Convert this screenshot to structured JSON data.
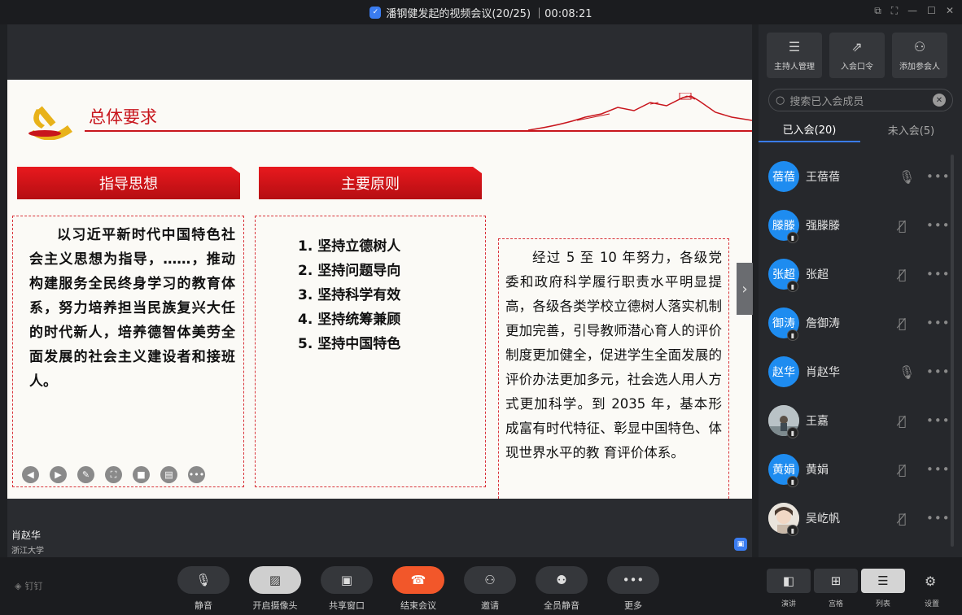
{
  "window": {
    "title": "潘钢健发起的视频会议(20/25) ｜00:08:21",
    "controls": [
      "⧉",
      "⛶",
      "—",
      "☐",
      "✕"
    ]
  },
  "slide": {
    "title": "总体要求",
    "banner_left": "指导思想",
    "banner_middle": "主要原则",
    "guiding_text": "以习近平新时代中国特色社会主义思想为指导，……，推动构建服务全民终身学习的教育体系，努力培养担当民族复兴大任 的时代新人，培养德智体美劳全面发展的社会主义建设者和接班人。",
    "principles": [
      "1. 坚持立德树人",
      "2. 坚持问题导向",
      "3. 坚持科学有效",
      "4. 坚持统筹兼顾",
      "5. 坚持中国特色"
    ],
    "goal_text": "经过 5 至 10 年努力，各级党委和政府科学履行职责水平明显提高，各级各类学校立德树人落实机制更加完善，引导教师潜心育人的评价制度更加健全，促进学生全面发展的评价办法更加多元，社会选人用人方式更加科学。到 2035 年，基本形成富有时代特征、彰显中国特色、体现世界水平的教 育评价体系。",
    "tools": [
      "◀",
      "▶",
      "✎",
      "⛶",
      "■",
      "▤",
      "•••"
    ],
    "next": "›"
  },
  "speaker": {
    "name": "肖赵华",
    "org": "浙江大学"
  },
  "panel": {
    "top_buttons": [
      {
        "icon": "☰",
        "label": "主持人管理"
      },
      {
        "icon": "⇗",
        "label": "入会口令"
      },
      {
        "icon": "⚇",
        "label": "添加参会人"
      }
    ],
    "search_placeholder": "搜索已入会成员",
    "tab_joined": "已入会(20)",
    "tab_not_joined": "未入会(5)",
    "members": [
      {
        "avatar": "蓓蓓",
        "name": "王蓓蓓",
        "muted": false
      },
      {
        "avatar": "滕滕",
        "name": "强滕滕",
        "muted": true
      },
      {
        "avatar": "张超",
        "name": "张超",
        "muted": true
      },
      {
        "avatar": "御涛",
        "name": "詹御涛",
        "muted": true
      },
      {
        "avatar": "赵华",
        "name": "肖赵华",
        "muted": false
      },
      {
        "avatar": "",
        "name": "王嘉",
        "muted": true
      },
      {
        "avatar": "黄娟",
        "name": "黄娟",
        "muted": true
      },
      {
        "avatar": "",
        "name": "吴屹帆",
        "muted": true
      }
    ]
  },
  "toolbar": {
    "brand": "钉钉",
    "mute": "静音",
    "camera": "开启摄像头",
    "share": "共享窗口",
    "end": "结束会议",
    "invite": "邀请",
    "mute_all": "全员静音",
    "more": "更多",
    "view_speaker": "演讲",
    "view_grid": "宫格",
    "view_list": "列表",
    "settings": "设置"
  },
  "colors": {
    "accent": "#3a7cf0",
    "end_call": "#f2572a",
    "slide_red": "#c8161d"
  }
}
